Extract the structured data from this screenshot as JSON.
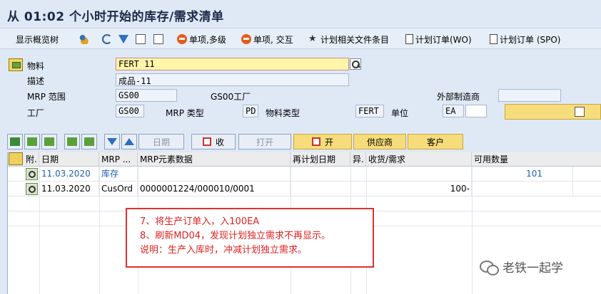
{
  "window": {
    "title": "从 01:02 个小时开始的库存/需求清单"
  },
  "toolbar": {
    "items": [
      {
        "label": "显示概览树",
        "icon": "tree-icon"
      },
      {
        "label": "",
        "icon": "people-icon"
      },
      {
        "label": "",
        "icon": "refresh-icon"
      },
      {
        "label": "",
        "icon": "filter-icon"
      },
      {
        "label": "",
        "icon": "calculator-icon"
      },
      {
        "label": "单项,多级",
        "icon": "stop-icon"
      },
      {
        "label": "单项, 交互",
        "icon": "stop-icon"
      },
      {
        "label": "计划相关文件条目",
        "icon": "link-icon"
      },
      {
        "label": "计划订单(WO)",
        "icon": "document-icon"
      },
      {
        "label": "计划订单 (SPO)",
        "icon": "document-icon"
      }
    ]
  },
  "header": {
    "material_label": "物料",
    "material_value": "FERT 11",
    "description_label": "描述",
    "description_value": "成品-11",
    "mrp_area_label": "MRP 范围",
    "mrp_area_value": "GS00",
    "mrp_area_text": "GS00工厂",
    "external_vendor_label": "外部制造商",
    "external_vendor_value": "",
    "plant_label": "工厂",
    "plant_value": "GS00",
    "mrp_type_label": "MRP 类型",
    "mrp_type_value": "PD",
    "material_type_label": "物料类型",
    "material_type_value": "FERT",
    "unit_label": "单位",
    "unit_value": "EA"
  },
  "buttons": {
    "date": "日期",
    "receipt": "收",
    "print": "打开",
    "open": "开",
    "vendor": "供应商",
    "customer": "客户"
  },
  "grid": {
    "columns": [
      "附.",
      "日期",
      "MRP ...",
      "MRP元素数据",
      "再计划日期",
      "异.",
      "收货/需求",
      "可用数量"
    ],
    "rows": [
      {
        "date": "11.03.2020",
        "mrp_element": "库存",
        "element_data": "",
        "reschedule_date": "",
        "exception": "",
        "receipt_requirement": "",
        "available_qty": "101"
      },
      {
        "date": "11.03.2020",
        "mrp_element": "CusOrd",
        "element_data": "0000001224/000010/0001",
        "reschedule_date": "",
        "exception": "",
        "receipt_requirement": "100-",
        "available_qty": ""
      }
    ]
  },
  "annotation": {
    "line1": "7、将生产订单入，入100EA",
    "line2": "8、刷新MD04，发现计划独立需求不再显示。",
    "line3": "说明：生产入库时，冲减计划独立需求。"
  },
  "watermark": {
    "text": "老铁一起学"
  }
}
